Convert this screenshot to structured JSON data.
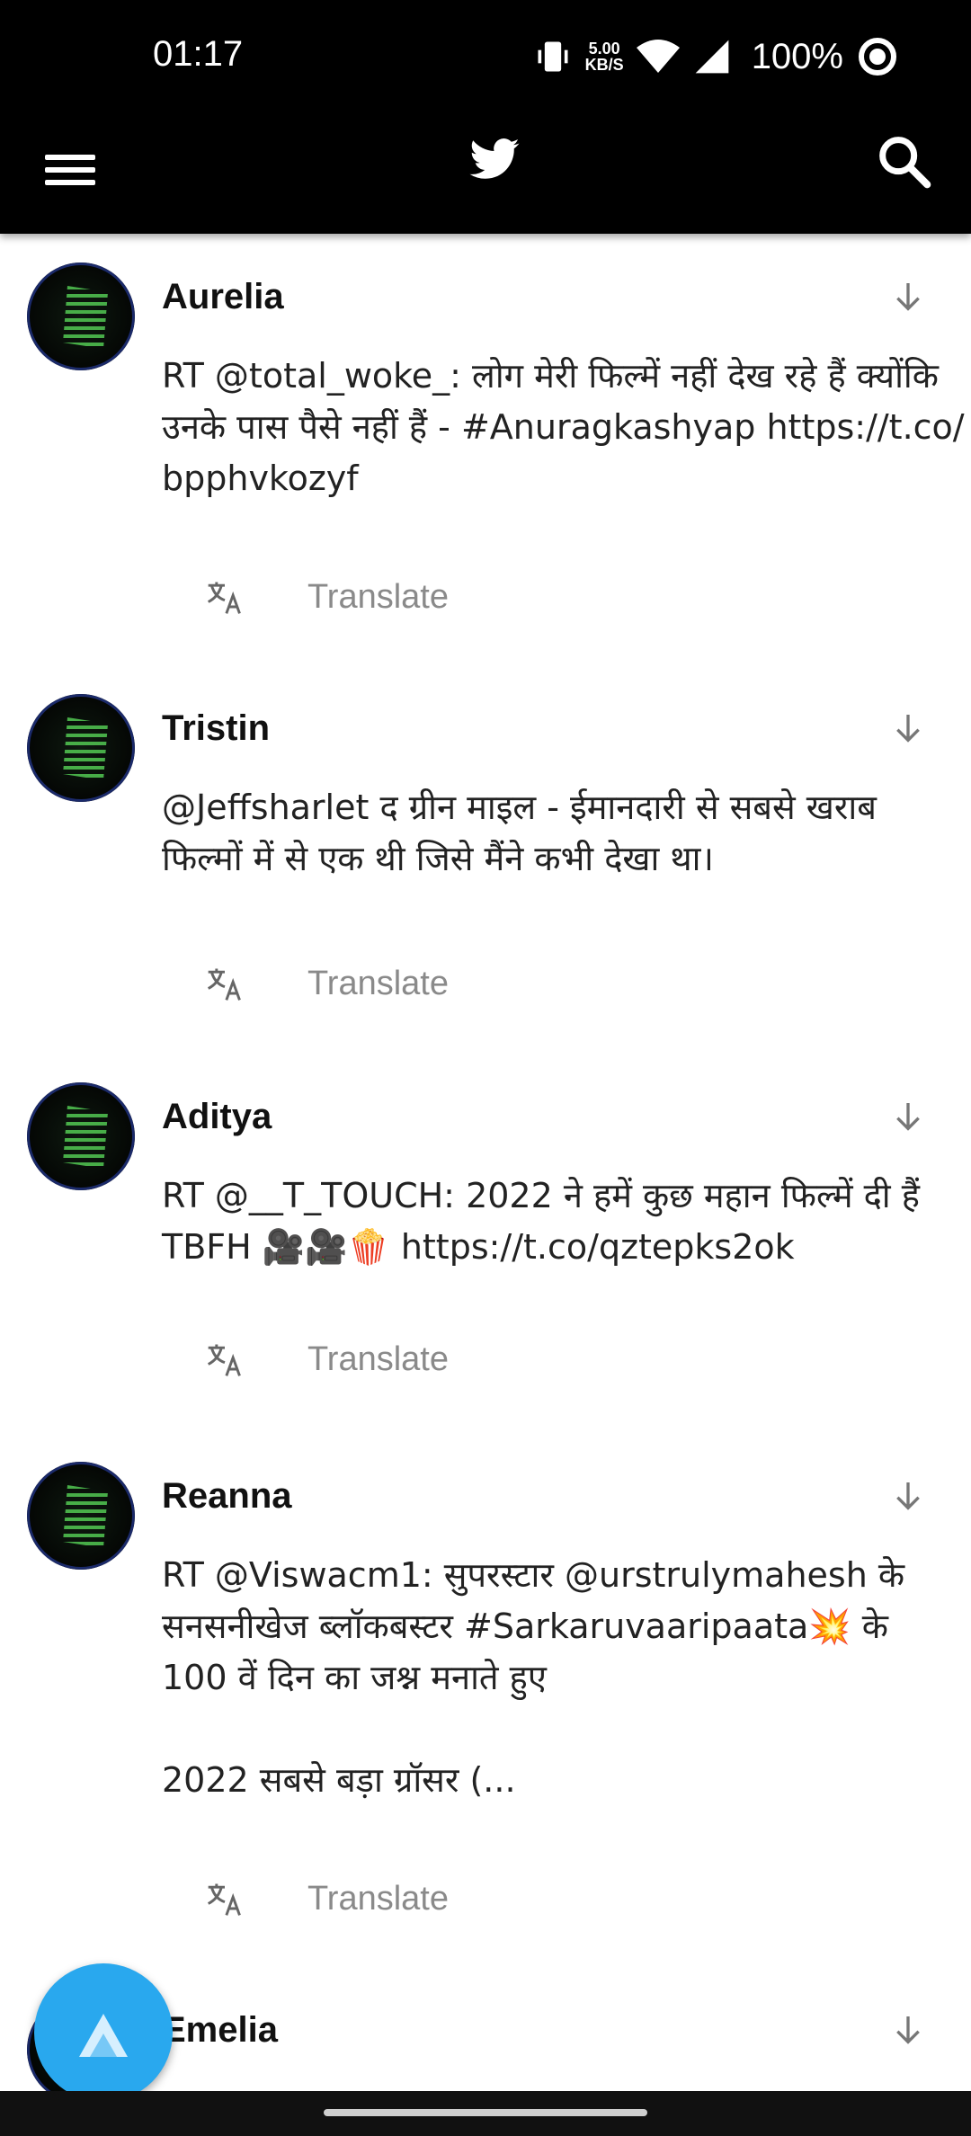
{
  "status_bar": {
    "time": "01:17",
    "net_speed_value": "5.00",
    "net_speed_unit": "KB/S",
    "battery": "100%"
  },
  "app_bar": {
    "menu_icon": "hamburger-menu-icon",
    "logo_icon": "twitter-bird-icon",
    "search_icon": "search-icon"
  },
  "tweets": [
    {
      "user": "Aurelia",
      "text": "RT @total_woke_: लोग मेरी फिल्में नहीं देख रहे हैं क्योंकि\nउनके पास पैसे नहीं हैं - #Anuragkashyap https://t.co/\nbpphvkozyf",
      "translate": "Translate"
    },
    {
      "user": "Tristin",
      "text": "@Jeffsharlet द ग्रीन माइल - ईमानदारी से सबसे खराब\nफिल्मों में से एक थी जिसे मैंने कभी देखा था।",
      "translate": "Translate"
    },
    {
      "user": "Aditya",
      "text": "RT @__T_TOUCH: 2022 ने हमें कुछ महान फिल्में दी हैं\nTBFH 🎥🎥🍿 https://t.co/qztepks2ok",
      "translate": "Translate"
    },
    {
      "user": "Reanna",
      "text": "RT @Viswacm1: सुपरस्टार @urstrulymahesh के\nसनसनीखेज ब्लॉकबस्टर #Sarkaruvaaripaata💥 के\n100 वें दिन का जश्न मनाते हुए\n\n2022 सबसे बड़ा ग्रॉसर (...",
      "translate": "Translate"
    },
    {
      "user": "Emelia"
    }
  ],
  "colors": {
    "bar_background": "#000000",
    "fab": "#29a8ee",
    "translate_text": "#8a8a8a"
  }
}
